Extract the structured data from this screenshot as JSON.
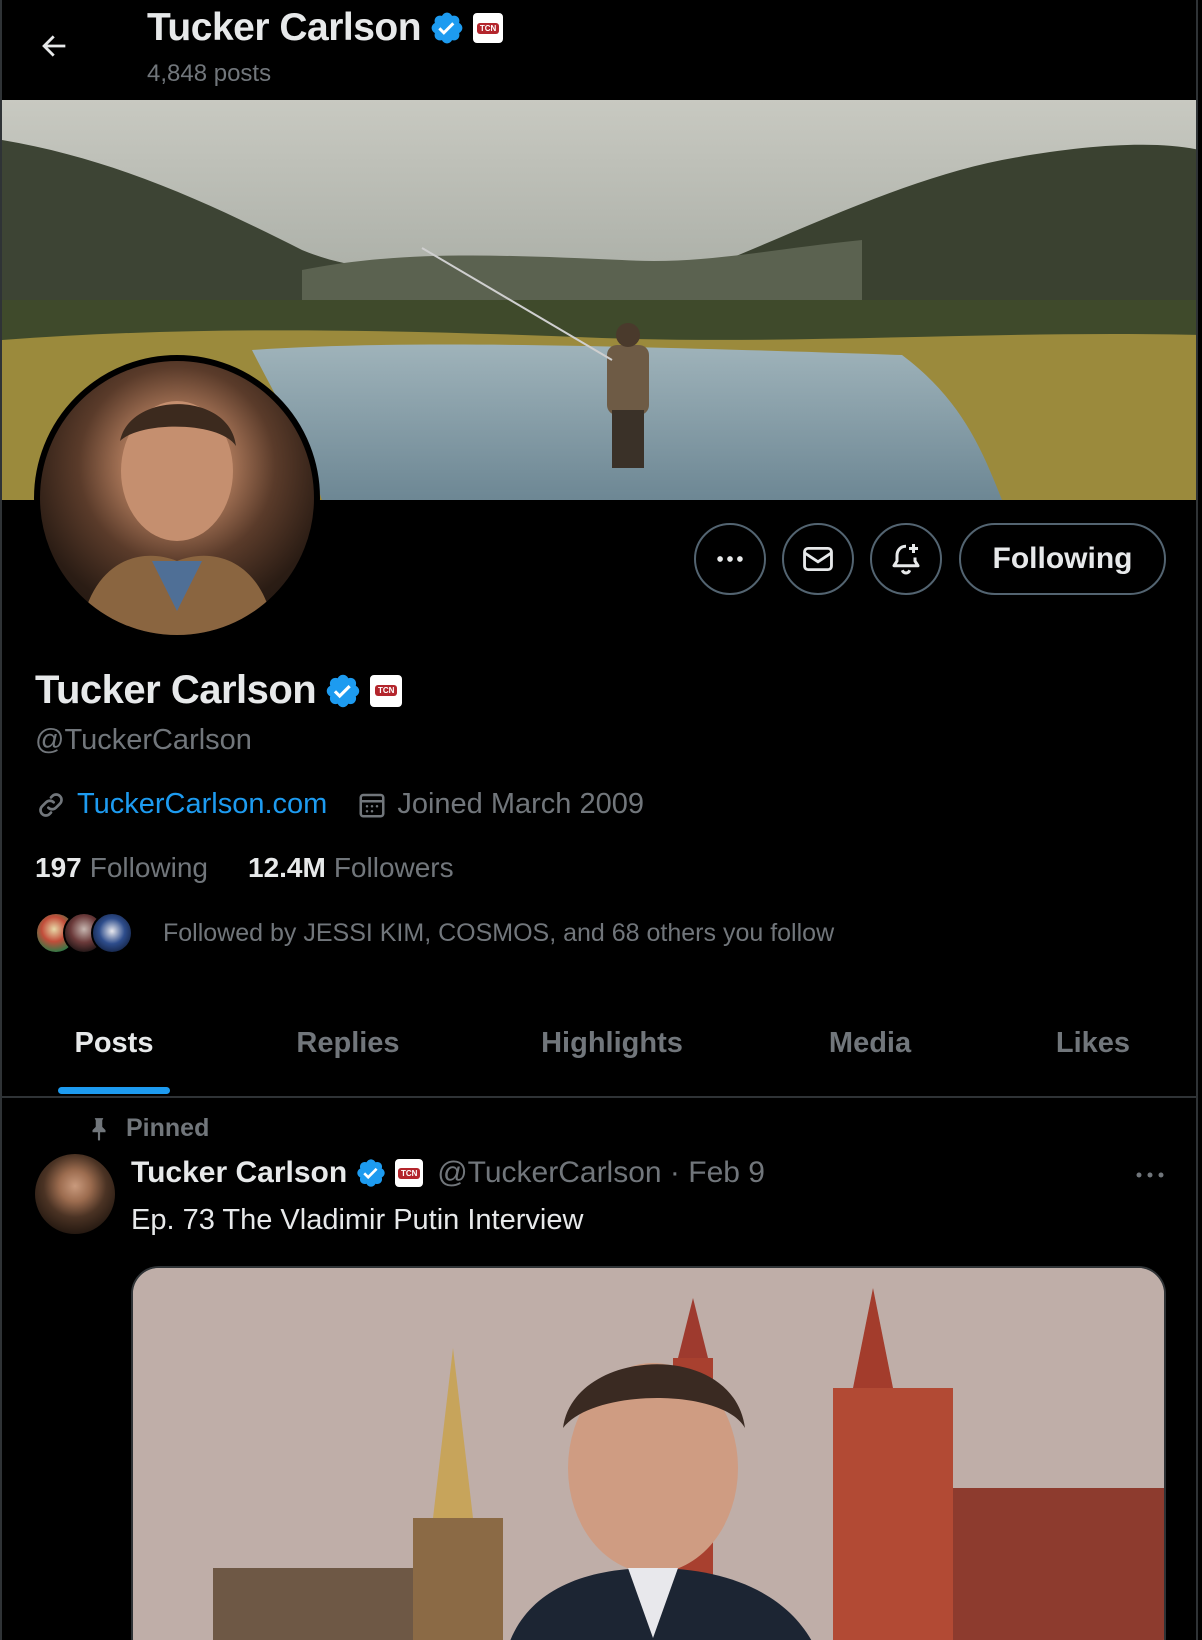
{
  "header": {
    "name": "Tucker Carlson",
    "posts_count": "4,848 posts",
    "badge_label": "TCN"
  },
  "profile": {
    "name": "Tucker Carlson",
    "handle": "@TuckerCarlson",
    "badge_label": "TCN",
    "website": "TuckerCarlson.com",
    "joined": "Joined March 2009",
    "following_count": "197",
    "following_label": "Following",
    "followers_count": "12.4M",
    "followers_label": "Followers",
    "followed_by": "Followed by JESSI KIM, COSMOS, and 68 others you follow"
  },
  "actions": {
    "follow_state": "Following"
  },
  "tabs": [
    {
      "label": "Posts",
      "active": true
    },
    {
      "label": "Replies",
      "active": false
    },
    {
      "label": "Highlights",
      "active": false
    },
    {
      "label": "Media",
      "active": false
    },
    {
      "label": "Likes",
      "active": false
    }
  ],
  "pinned_post": {
    "pinned_label": "Pinned",
    "author_name": "Tucker Carlson",
    "badge_label": "TCN",
    "meta": "@TuckerCarlson · Feb 9",
    "text": "Ep. 73  The Vladimir Putin Interview"
  },
  "colors": {
    "accent": "#1d9bf0",
    "background": "#000000",
    "muted": "#71767b",
    "border": "#2f3336",
    "verified": "#1d9bf0"
  }
}
